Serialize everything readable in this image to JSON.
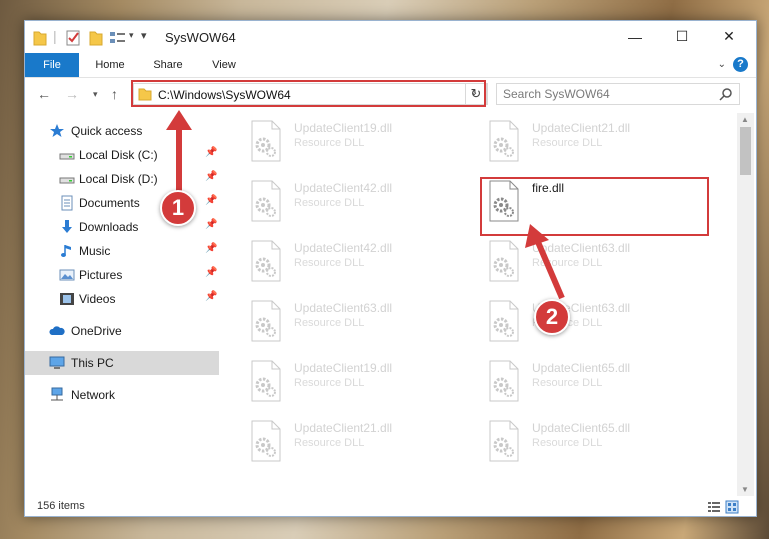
{
  "window": {
    "title": "SysWOW64",
    "minimize_label": "—",
    "maximize_label": "☐",
    "close_label": "✕"
  },
  "ribbon": {
    "tabs": [
      "File",
      "Home",
      "Share",
      "View"
    ],
    "expand_icon": "chevron-down-icon",
    "help_label": "?"
  },
  "navigation": {
    "back_icon": "arrow-left-icon",
    "forward_icon": "arrow-right-icon",
    "recent_icon": "chevron-down-icon",
    "up_icon": "arrow-up-icon",
    "address": "C:\\Windows\\SysWOW64",
    "search_placeholder": "Search SysWOW64"
  },
  "sidebar": {
    "items": [
      {
        "label": "Quick access",
        "icon": "star-icon"
      },
      {
        "label": "Local Disk (C:)",
        "icon": "drive-icon",
        "pinned": true
      },
      {
        "label": "Local Disk (D:)",
        "icon": "drive-icon",
        "pinned": true
      },
      {
        "label": "Documents",
        "icon": "document-icon",
        "pinned": true
      },
      {
        "label": "Downloads",
        "icon": "download-icon",
        "pinned": true
      },
      {
        "label": "Music",
        "icon": "music-icon",
        "pinned": true
      },
      {
        "label": "Pictures",
        "icon": "pictures-icon",
        "pinned": true
      },
      {
        "label": "Videos",
        "icon": "videos-icon",
        "pinned": true
      },
      {
        "label": "OneDrive",
        "icon": "cloud-icon"
      },
      {
        "label": "This PC",
        "icon": "computer-icon",
        "selected": true
      },
      {
        "label": "Network",
        "icon": "network-icon"
      }
    ]
  },
  "files": [
    {
      "name": "UpdateClient19.dll",
      "type": "Resource DLL"
    },
    {
      "name": "UpdateClient21.dll",
      "type": "Resource DLL"
    },
    {
      "name": "UpdateClient42.dll",
      "type": "Resource DLL"
    },
    {
      "name": "fire.dll",
      "type": "",
      "highlighted": true
    },
    {
      "name": "UpdateClient42.dll",
      "type": "Resource DLL"
    },
    {
      "name": "UpdateClient63.dll",
      "type": "Resource DLL"
    },
    {
      "name": "UpdateClient63.dll",
      "type": "Resource DLL"
    },
    {
      "name": "UpdateClient63.dll",
      "type": "Resource DLL"
    },
    {
      "name": "UpdateClient19.dll",
      "type": "Resource DLL"
    },
    {
      "name": "UpdateClient65.dll",
      "type": "Resource DLL"
    },
    {
      "name": "UpdateClient21.dll",
      "type": "Resource DLL"
    },
    {
      "name": "UpdateClient65.dll",
      "type": "Resource DLL"
    }
  ],
  "status": {
    "item_count": "156 items"
  },
  "annotations": {
    "step1": "1",
    "step2": "2",
    "color": "#d33b3b"
  }
}
